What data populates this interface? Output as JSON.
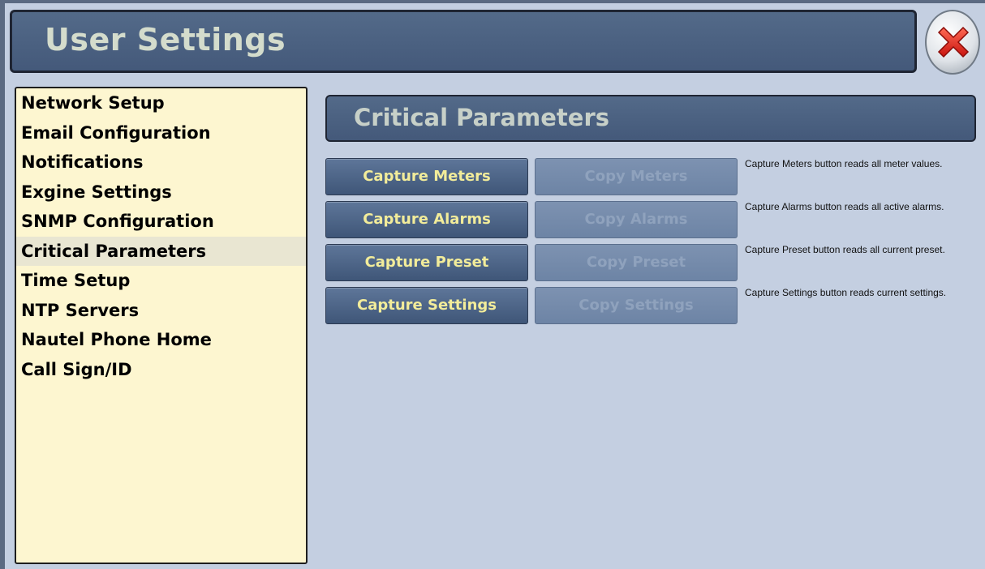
{
  "window": {
    "title": "User Settings",
    "close_icon": "close-x-icon"
  },
  "sidebar": {
    "items": [
      {
        "label": "Network Setup",
        "active": false
      },
      {
        "label": "Email Configuration",
        "active": false
      },
      {
        "label": "Notifications",
        "active": false
      },
      {
        "label": "Exgine Settings",
        "active": false
      },
      {
        "label": "SNMP Configuration",
        "active": false
      },
      {
        "label": "Critical Parameters",
        "active": true
      },
      {
        "label": "Time Setup",
        "active": false
      },
      {
        "label": "NTP Servers",
        "active": false
      },
      {
        "label": "Nautel Phone Home",
        "active": false
      },
      {
        "label": "Call Sign/ID",
        "active": false
      }
    ]
  },
  "main": {
    "section_title": "Critical Parameters",
    "rows": [
      {
        "capture_label": "Capture Meters",
        "copy_label": "Copy Meters",
        "description": "Capture Meters button reads all meter values."
      },
      {
        "capture_label": "Capture Alarms",
        "copy_label": "Copy Alarms",
        "description": "Capture Alarms button reads all active alarms."
      },
      {
        "capture_label": "Capture Preset",
        "copy_label": "Copy Preset",
        "description": "Capture Preset button reads all current preset."
      },
      {
        "capture_label": "Capture Settings",
        "copy_label": "Copy Settings",
        "description": "Capture Settings button reads current settings."
      }
    ]
  },
  "colors": {
    "accent_header": "#4b6081",
    "sidebar_bg": "#fdf6d0",
    "capture_text": "#f2ec9a",
    "copy_text_disabled": "#8fa2bd",
    "close_red": "#e0302a"
  }
}
